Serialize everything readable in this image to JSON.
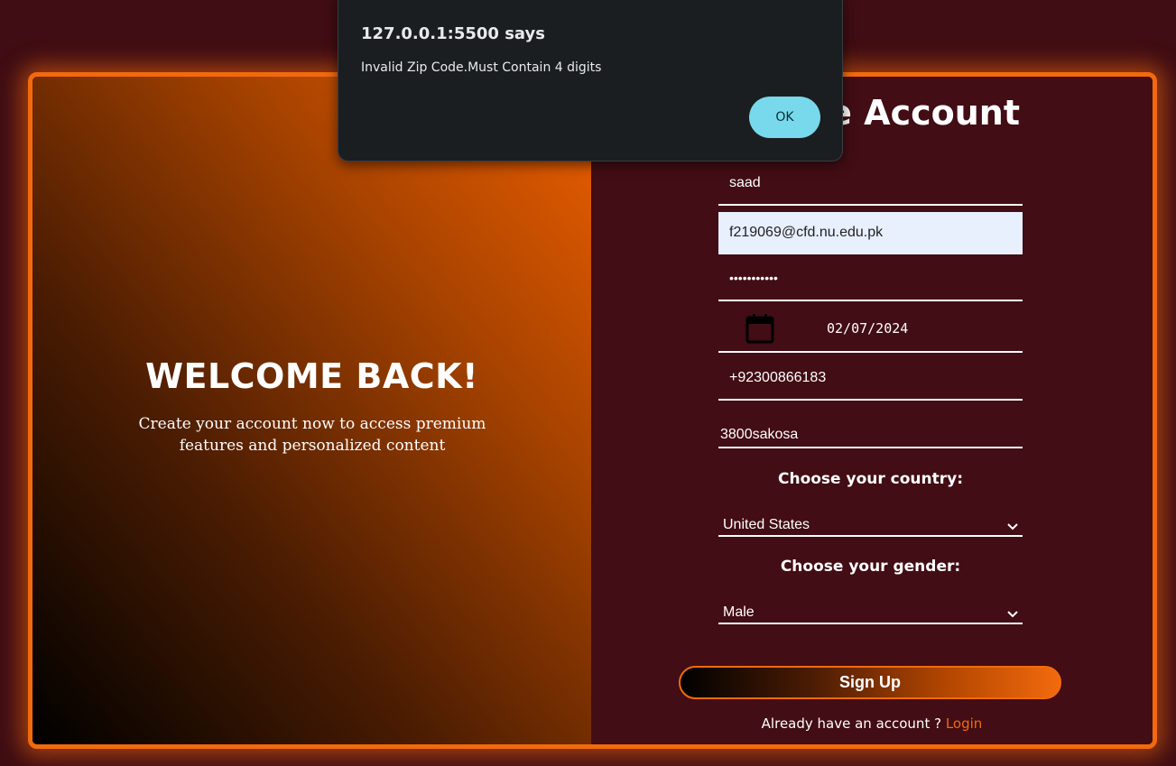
{
  "left_panel": {
    "title": "WELCOME BACK!",
    "subtitle": "Create your account now to access premium features and personalized content"
  },
  "form": {
    "title": "Create Account",
    "name_value": "saad",
    "email_value": "f219069@cfd.nu.edu.pk",
    "password_value": "•••••••••••",
    "date_value": "02/07/2024",
    "date_icon": "calendar-icon",
    "phone_value": "+92300866183",
    "zip_value": "3800sakosa",
    "country_label": "Choose your country:",
    "country_value": "United States",
    "gender_label": "Choose your gender:",
    "gender_value": "Male",
    "submit_label": "Sign Up",
    "login_prompt": "Already have an account ?",
    "login_link": "Login"
  },
  "alert_dialog": {
    "title": "127.0.0.1:5500 says",
    "message": "Invalid Zip Code.Must Contain 4 digits",
    "ok_label": "OK"
  },
  "colors": {
    "accent": "#f26a0d",
    "background": "#420d14",
    "dialog_bg": "#1b1e20",
    "ok_button": "#78d9ec"
  }
}
